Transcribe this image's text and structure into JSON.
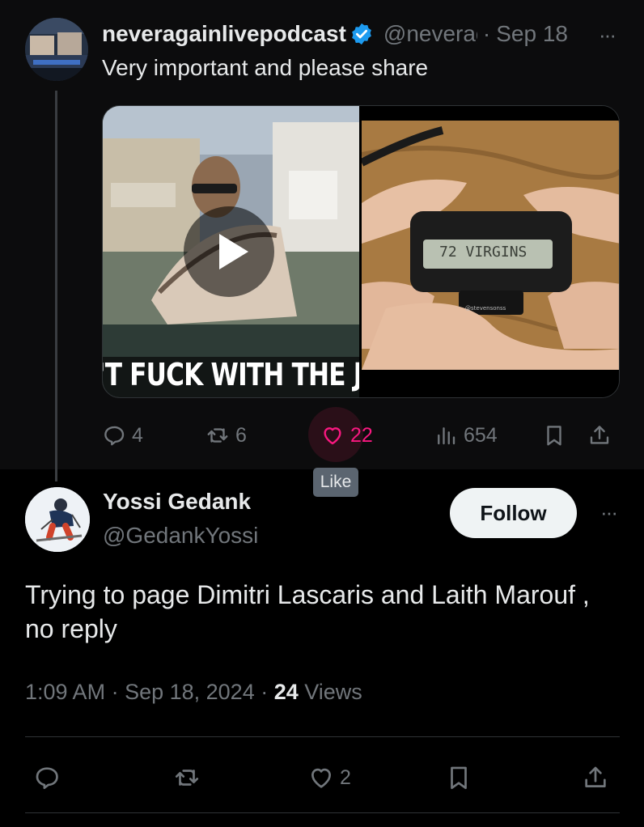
{
  "quoted_post": {
    "author_name": "neveragainlivepodcast",
    "handle": "@neveragainlivepodcast",
    "separator": "·",
    "date": "Sep 18",
    "more": "···",
    "text": "Very important and please share",
    "media": {
      "video_caption": "'T FUCK WITH THE J",
      "pager_text": "72 VIRGINS",
      "watermark": "@stevensonss"
    },
    "actions": {
      "replies": "4",
      "reposts": "6",
      "likes": "22",
      "views": "654"
    },
    "tooltip": "Like"
  },
  "main_post": {
    "author_name": "Yossi Gedank",
    "handle": "@GedankYossi",
    "follow_label": "Follow",
    "more": "···",
    "text": "Trying to page Dimitri Lascaris and Laith Marouf , no reply",
    "time": "1:09 AM",
    "sep1": " · ",
    "date": "Sep 18, 2024",
    "sep2": " · ",
    "views_count": "24",
    "views_label": " Views",
    "actions": {
      "likes": "2"
    }
  },
  "colors": {
    "accent_like": "#f91880",
    "verified": "#1d9bf0",
    "muted": "#71767b",
    "text": "#e7e9ea"
  },
  "icons": [
    "reply-icon",
    "repost-icon",
    "heart-icon",
    "views-icon",
    "bookmark-icon",
    "share-icon",
    "verified-icon",
    "play-icon"
  ]
}
